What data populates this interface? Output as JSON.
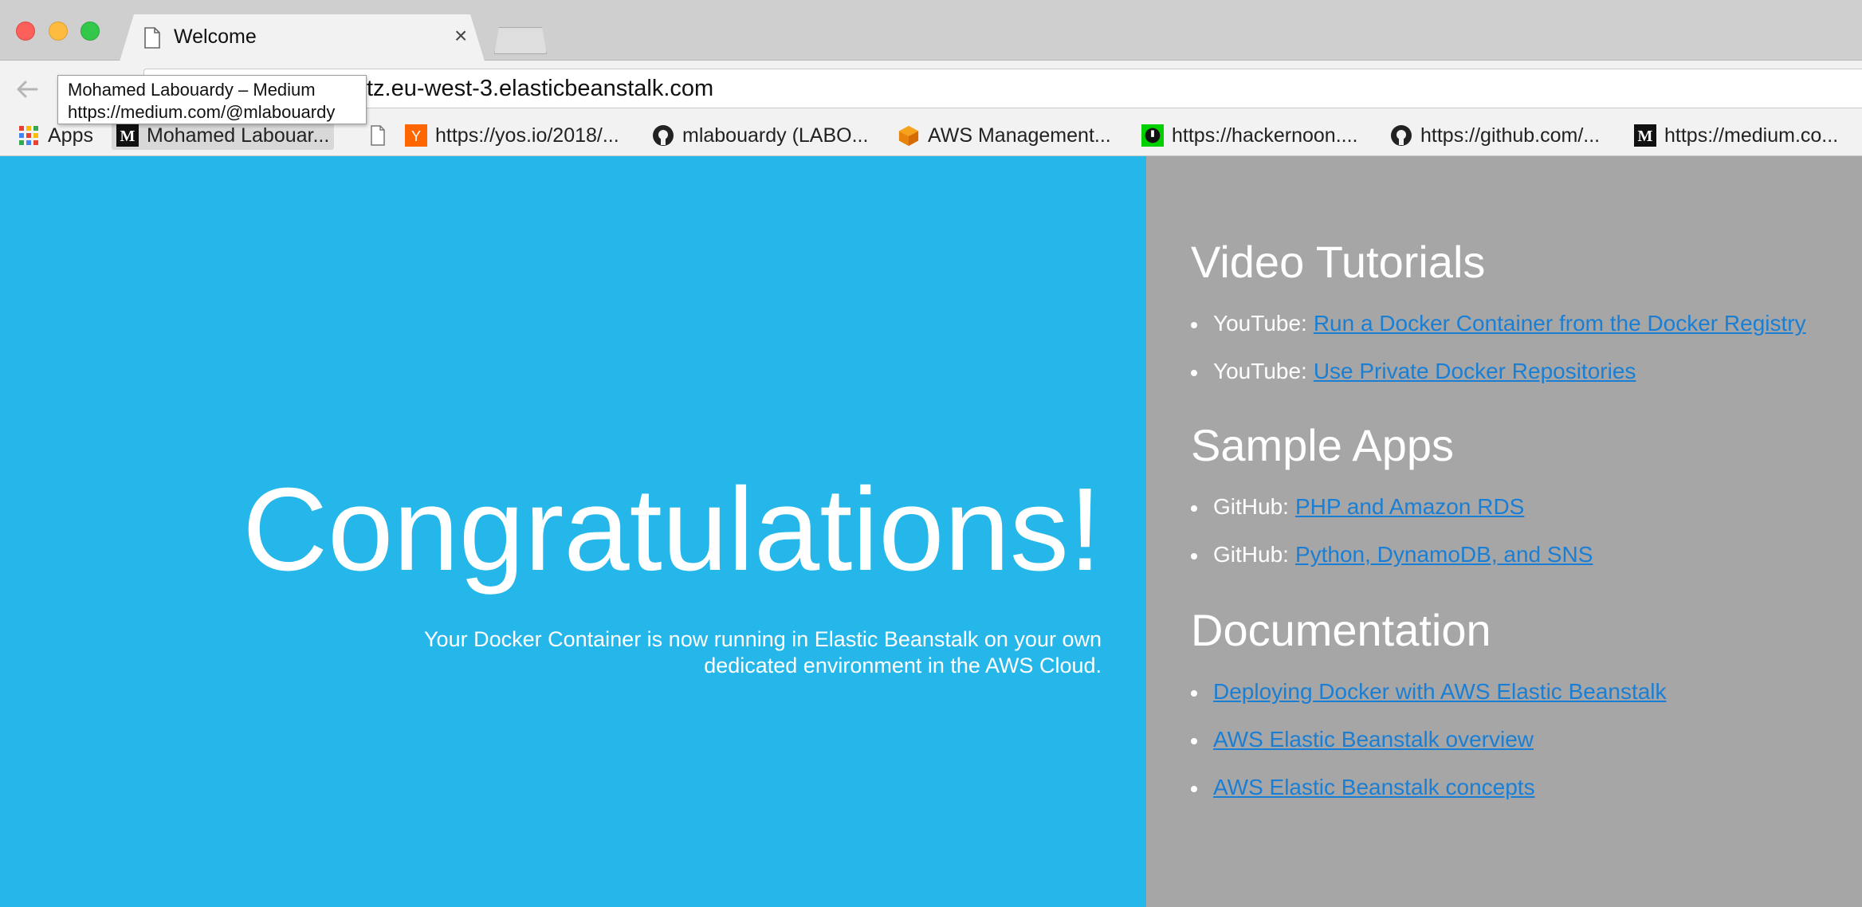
{
  "browser": {
    "tab": {
      "title": "Welcome",
      "close": "×"
    },
    "url": "tz.eu-west-3.elasticbeanstalk.com",
    "tooltip": {
      "line1": "Mohamed Labouardy – Medium",
      "line2": "https://medium.com/@mlabouardy"
    },
    "bookmarks": [
      {
        "label": "Apps",
        "icon": "apps-grid-icon"
      },
      {
        "label": "Mohamed Labouar...",
        "icon": "medium-icon"
      },
      {
        "label": "",
        "icon": "page-icon"
      },
      {
        "label": "https://yos.io/2018/...",
        "icon": "hackernews-icon"
      },
      {
        "label": "mlabouardy (LABO...",
        "icon": "github-icon"
      },
      {
        "label": "AWS Management...",
        "icon": "aws-cube-icon"
      },
      {
        "label": "https://hackernoon....",
        "icon": "hackernoon-icon"
      },
      {
        "label": "https://github.com/...",
        "icon": "github-icon"
      },
      {
        "label": "https://medium.co...",
        "icon": "medium-icon"
      }
    ]
  },
  "hero": {
    "title": "Congratulations!",
    "text": "Your Docker Container is now running in Elastic Beanstalk on your own dedicated environment in the AWS Cloud."
  },
  "sidebar": {
    "video": {
      "heading": "Video Tutorials",
      "items": [
        {
          "prefix": "YouTube:",
          "link": "Run a Docker Container from the Docker Registry"
        },
        {
          "prefix": "YouTube:",
          "link": "Use Private Docker Repositories"
        }
      ]
    },
    "samples": {
      "heading": "Sample Apps",
      "items": [
        {
          "prefix": "GitHub:",
          "link": "PHP and Amazon RDS"
        },
        {
          "prefix": "GitHub:",
          "link": "Python, DynamoDB, and SNS"
        }
      ]
    },
    "docs": {
      "heading": "Documentation",
      "items": [
        {
          "link": "Deploying Docker with AWS Elastic Beanstalk"
        },
        {
          "link": "AWS Elastic Beanstalk overview"
        },
        {
          "link": "AWS Elastic Beanstalk concepts"
        }
      ]
    }
  },
  "colors": {
    "hero_bg": "#25b7e9",
    "sidebar_bg": "#a6a6a6",
    "link": "#1a7fd4"
  }
}
